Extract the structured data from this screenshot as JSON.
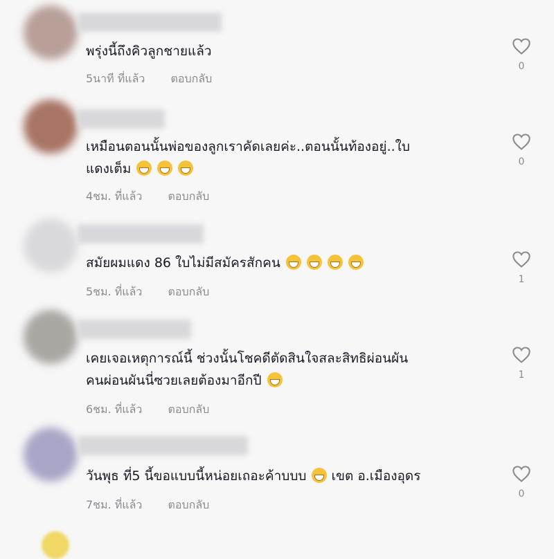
{
  "comments": [
    {
      "text": "พรุ่งนี้ถึงคิวลูกชายแล้ว",
      "time": "5นาที ที่แล้ว",
      "reply": "ตอบกลับ",
      "likes": "0",
      "emoji_count": 0
    },
    {
      "text": "เหมือนตอนนั้นพ่อของลูกเราคัดเลยค่ะ..ตอนนั้นท้องอยู่..ใบ\nแดงเต็ม",
      "time": "4ชม. ที่แล้ว",
      "reply": "ตอบกลับ",
      "likes": "0",
      "emoji_count": 3
    },
    {
      "text": "สมัยผมแดง 86 ใบไม่มีสมัครสักคน",
      "time": "5ชม. ที่แล้ว",
      "reply": "ตอบกลับ",
      "likes": "1",
      "emoji_count": 4
    },
    {
      "text": "เคยเจอเหตุการณ์นี้ ช่วงนั้นโชคดีตัดสินใจสละสิทธิผ่อนผัน\nคนผ่อนผันนี่ซวยเลยต้องมาอีกปี",
      "time": "6ชม. ที่แล้ว",
      "reply": "ตอบกลับ",
      "likes": "1",
      "emoji_count": 1
    },
    {
      "text": "วันพุธ ที่5 นี้ขอแบบนี้หน่อยเถอะค้าบบบ",
      "text_suffix": " เขต อ.เมืองอุดร",
      "time": "7ชม. ที่แล้ว",
      "reply": "ตอบกลับ",
      "likes": "0",
      "emoji_count": 1
    }
  ],
  "icons": {
    "like": "heart-outline-icon",
    "emoji": "grinning-face-icon"
  },
  "colors": {
    "background": "#f7f7f7",
    "text": "#161823",
    "meta": "#8a8b91"
  }
}
